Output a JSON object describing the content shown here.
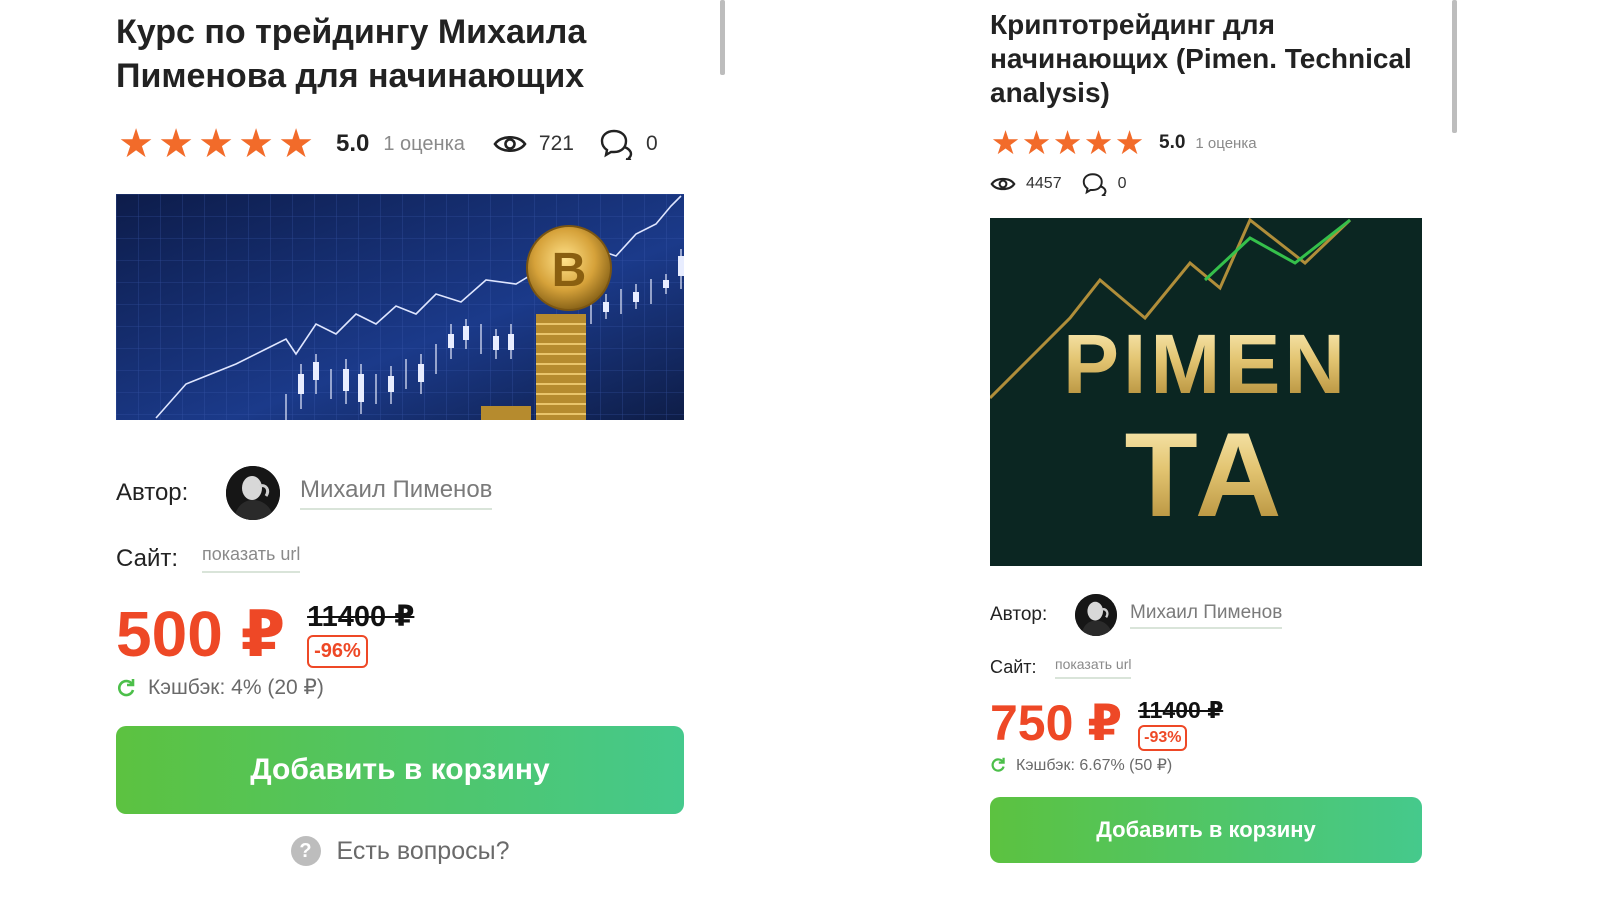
{
  "cards": [
    {
      "title": "Курс по трейдингу Михаила Пименова для начинающих",
      "rating_value": "5.0",
      "rating_count": "1 оценка",
      "stars": 5,
      "views": "721",
      "comments": "0",
      "author_label": "Автор:",
      "author_name": "Михаил Пименов",
      "site_label": "Сайт:",
      "site_link": "показать url",
      "price": "500 ₽",
      "old_price": "11400 ₽",
      "discount": "-96%",
      "cashback": "Кэшбэк: 4% (20 ₽)",
      "cart_button": "Добавить в корзину",
      "help": "Есть вопросы?"
    },
    {
      "title": "Криптотрейдинг для начинающих (Pimen. Technical analysis)",
      "rating_value": "5.0",
      "rating_count": "1 оценка",
      "stars": 5,
      "views": "4457",
      "comments": "0",
      "author_label": "Автор:",
      "author_name": "Михаил Пименов",
      "site_label": "Сайт:",
      "site_link": "показать url",
      "price": "750 ₽",
      "old_price": "11400 ₽",
      "discount": "-93%",
      "cashback": "Кэшбэк: 6.67% (50 ₽)",
      "cart_button": "Добавить в корзину",
      "banner_text_line1": "PIMEN",
      "banner_text_line2": "TA"
    }
  ],
  "colors": {
    "accent_price": "#ee4826",
    "star": "#f26b2a",
    "button_start": "#5cc240",
    "button_end": "#45c98c"
  },
  "icons": [
    "star-icon",
    "eye-icon",
    "comments-icon",
    "cashback-icon",
    "help-icon"
  ]
}
